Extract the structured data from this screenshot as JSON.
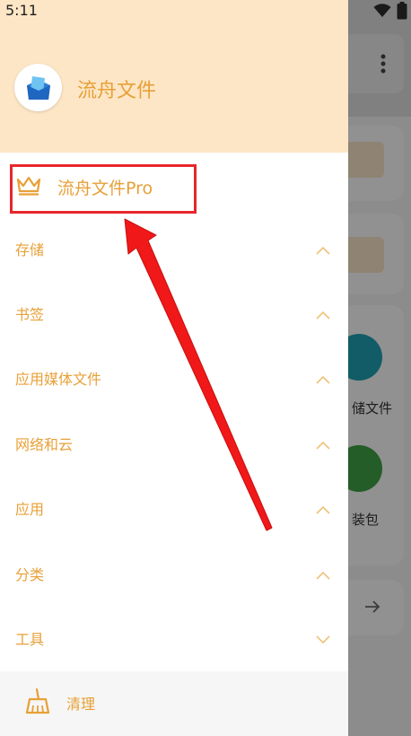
{
  "status_bar": {
    "time": "5:11",
    "icons": [
      "wifi-icon",
      "battery-icon"
    ]
  },
  "drawer": {
    "app_name": "流舟文件",
    "pro_item": {
      "label": "流舟文件Pro",
      "icon": "crown-icon"
    },
    "menu_items": [
      {
        "label": "存储",
        "chevron": "up"
      },
      {
        "label": "书签",
        "chevron": "up"
      },
      {
        "label": "应用媒体文件",
        "chevron": "up"
      },
      {
        "label": "网络和云",
        "chevron": "up"
      },
      {
        "label": "应用",
        "chevron": "up"
      },
      {
        "label": "分类",
        "chevron": "up"
      },
      {
        "label": "工具",
        "chevron": "down"
      }
    ],
    "footer": {
      "label": "清理",
      "icon": "broom-icon"
    }
  },
  "background": {
    "labels": [
      "储文件",
      "装包"
    ]
  },
  "colors": {
    "accent": "#e8a037",
    "header_bg": "#fde6c6",
    "highlight": "#e8262c"
  }
}
